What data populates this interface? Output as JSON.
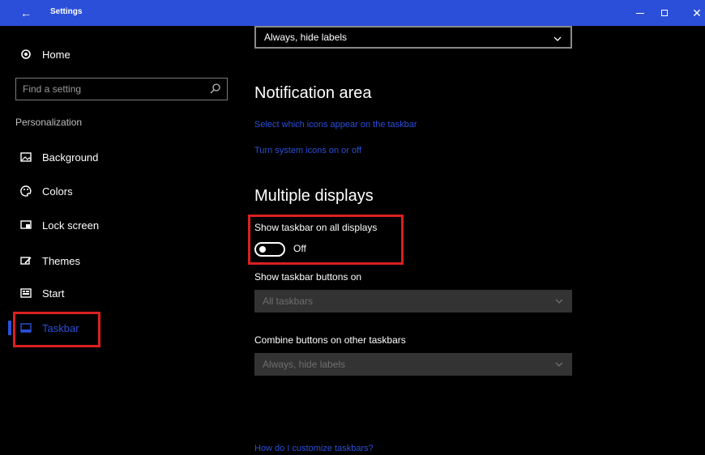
{
  "window": {
    "title": "Settings",
    "back_icon": "arrow-left-icon",
    "minimize_icon": "minimize-icon",
    "maximize_icon": "maximize-icon",
    "close_icon": "close-icon",
    "accent_color": "#2b4fd8",
    "highlight_color": "#d9201f"
  },
  "sidebar": {
    "home_label": "Home",
    "search_placeholder": "Find a setting",
    "section_label": "Personalization",
    "items": [
      {
        "label": "Background",
        "icon": "picture-icon"
      },
      {
        "label": "Colors",
        "icon": "palette-icon"
      },
      {
        "label": "Lock screen",
        "icon": "lock-screen-icon"
      },
      {
        "label": "Themes",
        "icon": "themes-icon"
      },
      {
        "label": "Start",
        "icon": "start-icon"
      },
      {
        "label": "Taskbar",
        "icon": "taskbar-icon",
        "active": true
      }
    ]
  },
  "main": {
    "top_dropdown": {
      "value": "Always, hide labels"
    },
    "notification_area": {
      "heading": "Notification area",
      "link1": "Select which icons appear on the taskbar",
      "link2": "Turn system icons on or off"
    },
    "multiple_displays": {
      "heading": "Multiple displays",
      "show_taskbar_label": "Show taskbar on all displays",
      "toggle_state": "Off",
      "show_buttons_label": "Show taskbar buttons on",
      "show_buttons_value": "All taskbars",
      "combine_label": "Combine buttons on other taskbars",
      "combine_value": "Always, hide labels"
    },
    "help_link": "How do I customize taskbars?"
  }
}
